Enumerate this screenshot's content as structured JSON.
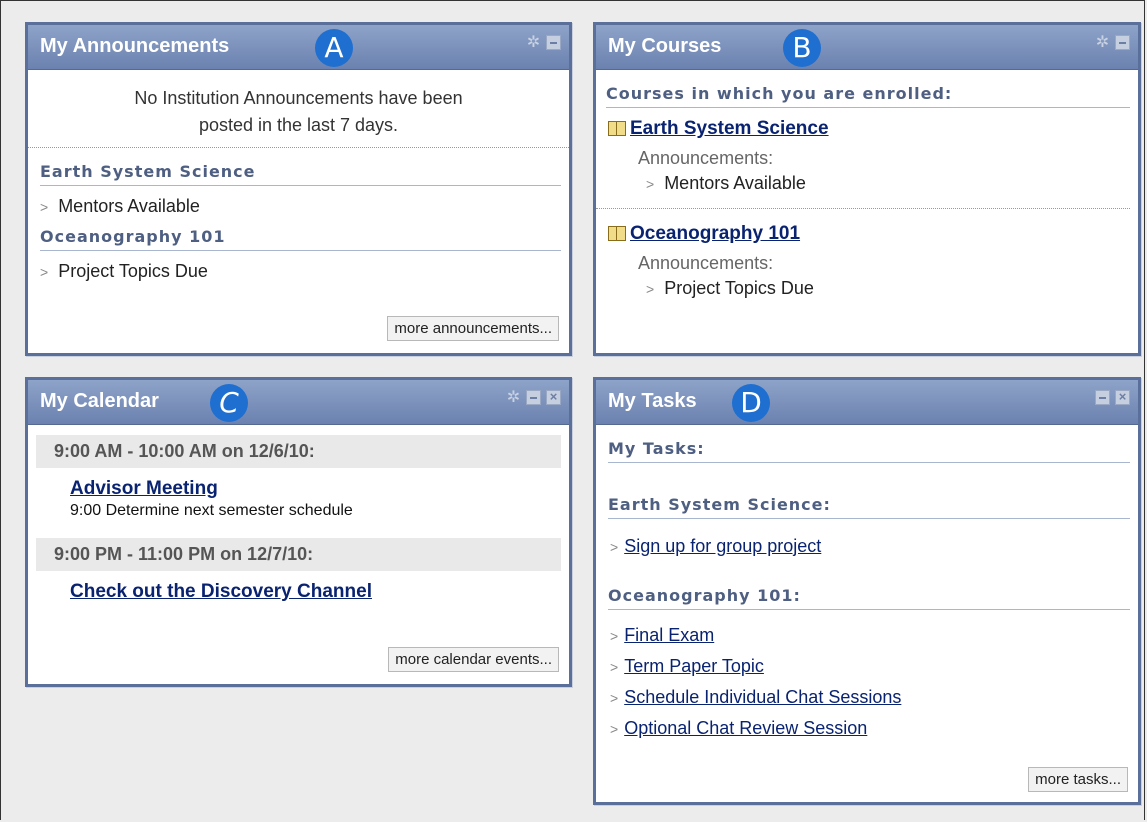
{
  "modules": {
    "announcements": {
      "title": "My Announcements",
      "badge": "A",
      "institution_note_line1": "No Institution Announcements have been",
      "institution_note_line2": "posted in the last 7 days.",
      "groups": [
        {
          "course": "Earth System Science",
          "item": "Mentors Available"
        },
        {
          "course": "Oceanography 101",
          "item": "Project Topics Due"
        }
      ],
      "more_button": "more announcements..."
    },
    "courses": {
      "title": "My Courses",
      "badge": "B",
      "heading": "Courses in which you are enrolled:",
      "list": [
        {
          "name": "Earth System Science",
          "ann_label": "Announcements:",
          "ann_item": "Mentors Available"
        },
        {
          "name": "Oceanography 101",
          "ann_label": "Announcements:",
          "ann_item": "Project Topics Due"
        }
      ]
    },
    "calendar": {
      "title": "My Calendar",
      "badge": "C",
      "events": [
        {
          "when": "9:00 AM - 10:00 AM on 12/6/10:",
          "title": "Advisor Meeting",
          "detail": "9:00 Determine next semester schedule"
        },
        {
          "when": "9:00 PM - 11:00 PM on 12/7/10:",
          "title": "Check out the Discovery Channel",
          "detail": ""
        }
      ],
      "more_button": "more calendar events..."
    },
    "tasks": {
      "title": "My Tasks",
      "badge": "D",
      "heading": "My Tasks:",
      "groups": [
        {
          "course": "Earth System Science:",
          "items": [
            "Sign up for group project"
          ]
        },
        {
          "course": "Oceanography 101:",
          "items": [
            "Final Exam",
            "Term Paper Topic",
            "Schedule Individual Chat Sessions",
            "Optional Chat Review Session"
          ]
        }
      ],
      "more_button": "more tasks..."
    }
  },
  "colors": {
    "header": "#6b82b0",
    "border": "#5a6f99",
    "badge": "#1e6fd0",
    "link": "#0a2370"
  }
}
